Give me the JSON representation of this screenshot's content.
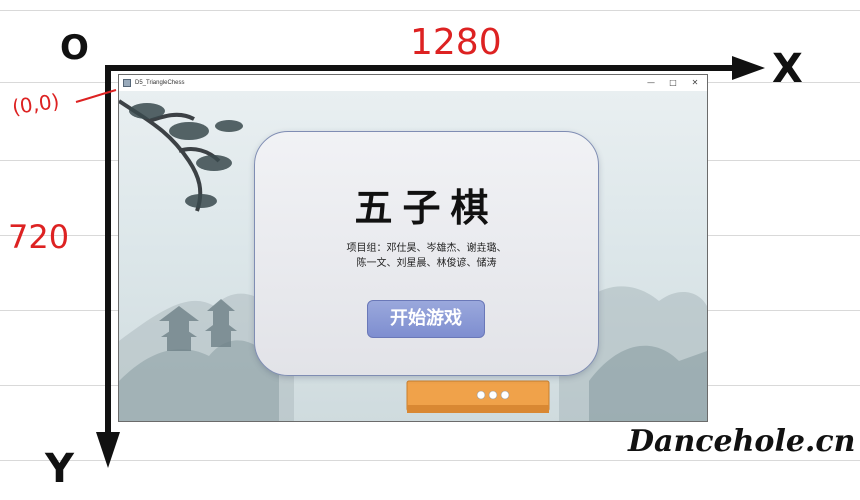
{
  "annotations": {
    "origin": "O",
    "x_width": "1280",
    "x_axis": "X",
    "y_axis": "Y",
    "y_height": "720",
    "origin_coord": "(0,0)"
  },
  "watermark": "Dancehole.cn",
  "window": {
    "title": "D5_TriangleChess",
    "minimize_glyph": "—",
    "maximize_glyph": "□",
    "close_glyph": "✕"
  },
  "dialog": {
    "title": "五子棋",
    "credits_line_1": "项目组：邓仕昊、岑雄杰、谢垚璐、",
    "credits_line_2": "陈一文、刘星晨、林俊谚、储涛",
    "start_button": "开始游戏"
  },
  "colors": {
    "annotation_red": "#d22222",
    "button_blue": "#8a98d4",
    "dialog_border": "#7f8db3"
  }
}
